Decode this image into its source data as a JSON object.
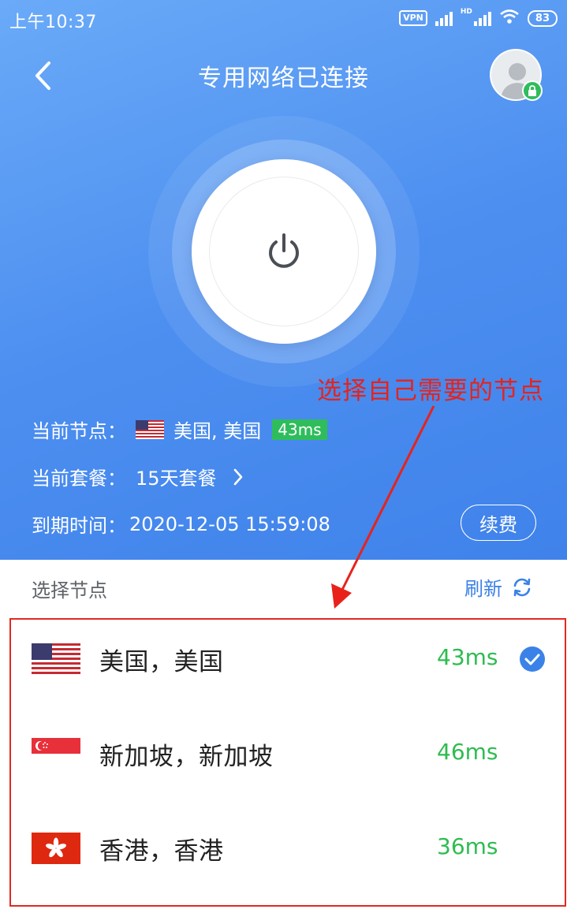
{
  "status_bar": {
    "time": "上午10:37",
    "vpn": "VPN",
    "hd": "HD",
    "battery": "83"
  },
  "header": {
    "back_icon": "chevron-left-icon",
    "title": "专用网络已连接",
    "avatar_icon": "user-avatar-icon",
    "lock_icon": "lock-icon"
  },
  "power": {
    "icon": "power-icon"
  },
  "annotation": {
    "text": "选择自己需要的节点",
    "color": "#e8221a"
  },
  "info": {
    "current_node_label": "当前节点：",
    "current_node_value": "美国, 美国",
    "current_node_latency": "43ms",
    "current_plan_label": "当前套餐：",
    "current_plan_value": "15天套餐",
    "expire_label": "到期时间：",
    "expire_value": "2020-12-05 15:59:08",
    "renew_label": "续费"
  },
  "section": {
    "title": "选择节点",
    "refresh_label": "刷新",
    "refresh_icon": "refresh-icon"
  },
  "nodes": [
    {
      "flag": "us-flag-icon",
      "name": "美国，美国",
      "latency": "43ms",
      "selected": true
    },
    {
      "flag": "sg-flag-icon",
      "name": "新加坡，新加坡",
      "latency": "46ms",
      "selected": false
    },
    {
      "flag": "hk-flag-icon",
      "name": "香港，香港",
      "latency": "36ms",
      "selected": false
    }
  ],
  "colors": {
    "primary_blue": "#4d8ff0",
    "latency_green": "#2ebc50",
    "annotation_red": "#e8221a",
    "check_blue": "#3b82e8"
  }
}
